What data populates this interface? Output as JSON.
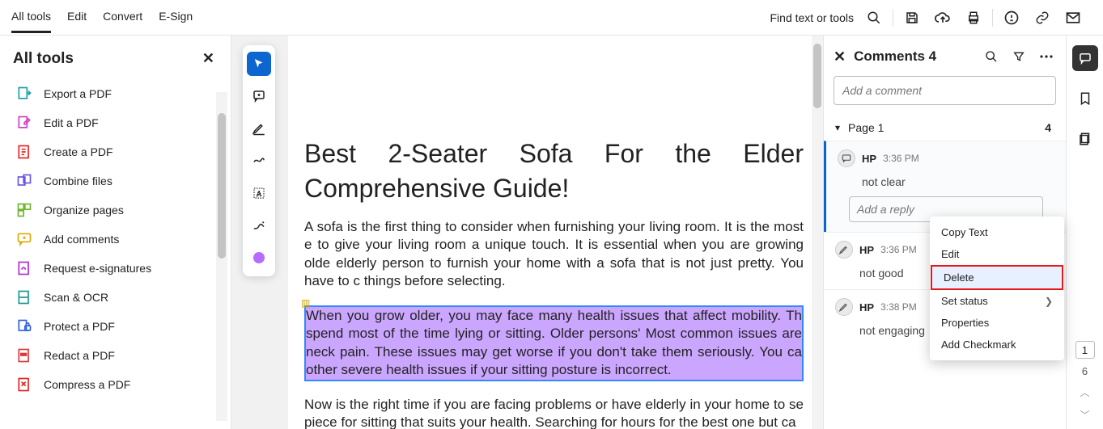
{
  "topbar": {
    "tabs": [
      "All tools",
      "Edit",
      "Convert",
      "E-Sign"
    ],
    "find_label": "Find text or tools"
  },
  "sidebar": {
    "title": "All tools",
    "items": [
      {
        "label": "Export a PDF",
        "accent": "#18a0a6"
      },
      {
        "label": "Edit a PDF",
        "accent": "#d13cc3"
      },
      {
        "label": "Create a PDF",
        "accent": "#e62222"
      },
      {
        "label": "Combine files",
        "accent": "#6b54e0"
      },
      {
        "label": "Organize pages",
        "accent": "#6fb62d"
      },
      {
        "label": "Add comments",
        "accent": "#e0a800"
      },
      {
        "label": "Request e-signatures",
        "accent": "#b229d1"
      },
      {
        "label": "Scan & OCR",
        "accent": "#1a988f"
      },
      {
        "label": "Protect a PDF",
        "accent": "#2f5fe0"
      },
      {
        "label": "Redact a PDF",
        "accent": "#d83a3a"
      },
      {
        "label": "Compress a PDF",
        "accent": "#e02222"
      }
    ]
  },
  "document": {
    "title_line1": "Best 2-Seater Sofa For the Elder",
    "title_line2": "Comprehensive Guide!",
    "para1": "A sofa is the first thing to consider when furnishing your living room. It is the most e to give your living room a unique touch. It is essential when you are growing olde elderly person to furnish your home with a sofa that is not just pretty. You have to c things before selecting.",
    "highlighted": "When you grow older, you may face many health issues that affect mobility. Th spend most of the time lying or sitting. Older persons' Most common issues are neck pain. These issues may get worse if you don't take them seriously. You ca other severe health issues if your sitting posture is incorrect.",
    "para3": "Now is the right time if you are facing problems or have elderly in your home to se piece for sitting that suits your health. Searching for hours for the best one but ca"
  },
  "comments": {
    "title": "Comments 4",
    "add_placeholder": "Add a comment",
    "page_label": "Page 1",
    "page_count": "4",
    "reply_placeholder": "Add a reply",
    "items": [
      {
        "author": "HP",
        "time": "3:36 PM",
        "body": "not clear"
      },
      {
        "author": "HP",
        "time": "3:36 PM",
        "body": "not good"
      },
      {
        "author": "HP",
        "time": "3:38 PM",
        "body": "not engaging"
      }
    ]
  },
  "context_menu": {
    "copy": "Copy Text",
    "edit": "Edit",
    "delete": "Delete",
    "set_status": "Set status",
    "properties": "Properties",
    "checkmark": "Add Checkmark"
  },
  "rail": {
    "page": "1",
    "total": "6"
  }
}
